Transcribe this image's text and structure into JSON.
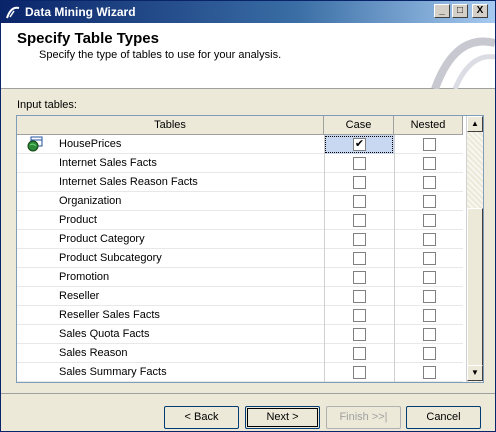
{
  "window": {
    "title": "Data Mining Wizard",
    "controls": {
      "minimize": "_",
      "maximize": "□",
      "close": "X"
    }
  },
  "header": {
    "title": "Specify Table Types",
    "subtitle": "Specify the type of tables to use for your analysis."
  },
  "input_label": "Input tables:",
  "grid": {
    "columns": [
      "Tables",
      "Case",
      "Nested"
    ],
    "rows": [
      {
        "name": "HousePrices",
        "case": true,
        "nested": false,
        "icon": "table-globe-icon"
      },
      {
        "name": "Internet Sales Facts",
        "case": false,
        "nested": false
      },
      {
        "name": "Internet Sales Reason Facts",
        "case": false,
        "nested": false
      },
      {
        "name": "Organization",
        "case": false,
        "nested": false
      },
      {
        "name": "Product",
        "case": false,
        "nested": false
      },
      {
        "name": "Product Category",
        "case": false,
        "nested": false
      },
      {
        "name": "Product Subcategory",
        "case": false,
        "nested": false
      },
      {
        "name": "Promotion",
        "case": false,
        "nested": false
      },
      {
        "name": "Reseller",
        "case": false,
        "nested": false
      },
      {
        "name": "Reseller Sales Facts",
        "case": false,
        "nested": false
      },
      {
        "name": "Sales Quota Facts",
        "case": false,
        "nested": false
      },
      {
        "name": "Sales Reason",
        "case": false,
        "nested": false
      },
      {
        "name": "Sales Summary Facts",
        "case": false,
        "nested": false
      }
    ]
  },
  "buttons": {
    "back": "< Back",
    "next": "Next >",
    "finish": "Finish >>|",
    "cancel": "Cancel"
  },
  "check_glyph": "✔"
}
